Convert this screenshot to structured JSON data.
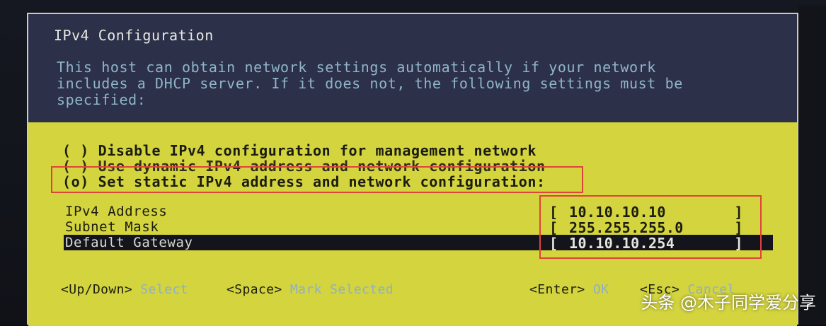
{
  "dialog": {
    "title": "IPv4 Configuration",
    "description": "This host can obtain network settings automatically if your network\nincludes a DHCP server. If it does not, the following settings must be\nspecified:"
  },
  "options": [
    {
      "marker": "( )",
      "label": "Disable IPv4 configuration for management network",
      "selected": false
    },
    {
      "marker": "( )",
      "label": "Use dynamic IPv4 address and network configuration",
      "selected": false
    },
    {
      "marker": "(o)",
      "label": "Set static IPv4 address and network configuration:",
      "selected": true
    }
  ],
  "fields": [
    {
      "label": "IPv4 Address",
      "value": "10.10.10.10",
      "focused": false
    },
    {
      "label": "Subnet Mask",
      "value": "255.255.255.0",
      "focused": false
    },
    {
      "label": "Default Gateway",
      "value": "10.10.10.254",
      "focused": true
    }
  ],
  "brackets": {
    "open": "[",
    "close": "]"
  },
  "footer": {
    "updown_key": "<Up/Down>",
    "updown_action": "Select",
    "space_key": "<Space>",
    "space_action": "Mark Selected",
    "enter_key": "<Enter>",
    "enter_action": "OK",
    "esc_key": "<Esc>",
    "esc_action": "Cancel"
  },
  "watermark": "头条 @木子同学爱分享",
  "colors": {
    "dialog_bg": "#2c3049",
    "panel_yellow": "#d3d43e",
    "highlight_box": "#e0433a",
    "description_text": "#8fb6c8"
  }
}
